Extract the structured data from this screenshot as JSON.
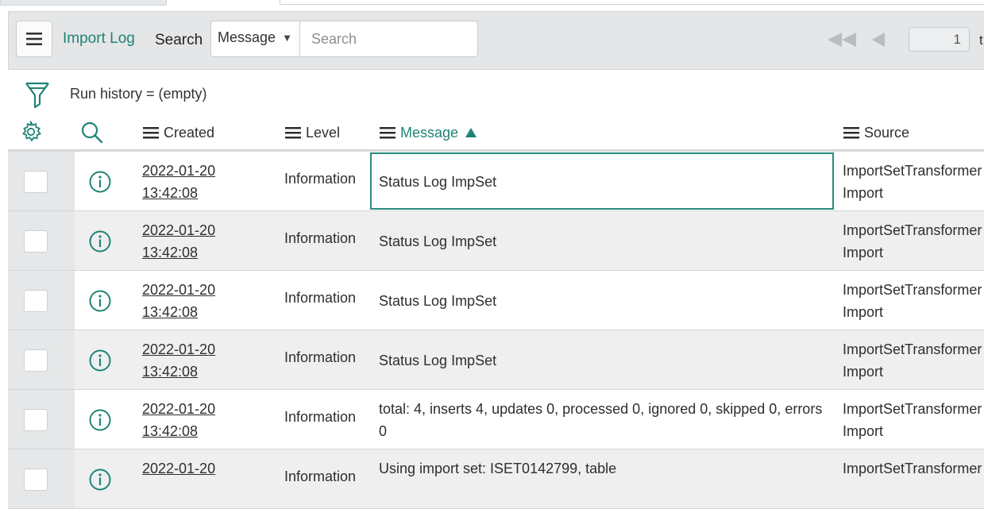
{
  "header": {
    "title": "Import Log",
    "search_label": "Search",
    "search_field": "Message",
    "search_placeholder": "Search",
    "page_number": "1",
    "page_suffix": "t"
  },
  "filter": {
    "breadcrumb": "Run history = (empty)"
  },
  "columns": {
    "created": "Created",
    "level": "Level",
    "message": "Message",
    "source": "Source"
  },
  "colors": {
    "accent": "#1f8476",
    "header_bg": "#e4e6e7",
    "row_alt": "#efefef"
  },
  "rows": [
    {
      "date": "2022-01-20",
      "time": "13:42:08",
      "level": "Information",
      "message": "Status Log ImpSet",
      "source1": "ImportSetTransformer",
      "source2": "Import"
    },
    {
      "date": "2022-01-20",
      "time": "13:42:08",
      "level": "Information",
      "message": "Status Log ImpSet",
      "source1": "ImportSetTransformer",
      "source2": "Import"
    },
    {
      "date": "2022-01-20",
      "time": "13:42:08",
      "level": "Information",
      "message": "Status Log ImpSet",
      "source1": "ImportSetTransformer",
      "source2": "Import"
    },
    {
      "date": "2022-01-20",
      "time": "13:42:08",
      "level": "Information",
      "message": "Status Log ImpSet",
      "source1": "ImportSetTransformer",
      "source2": "Import"
    },
    {
      "date": "2022-01-20",
      "time": "13:42:08",
      "level": "Information",
      "message": "total: 4, inserts 4, updates 0, processed 0, ignored 0, skipped 0, errors 0",
      "source1": "ImportSetTransformer",
      "source2": "Import"
    },
    {
      "date": "2022-01-20",
      "time": "",
      "level": "Information",
      "message": "Using import set: ISET0142799, table",
      "source1": "ImportSetTransformer",
      "source2": ""
    }
  ]
}
